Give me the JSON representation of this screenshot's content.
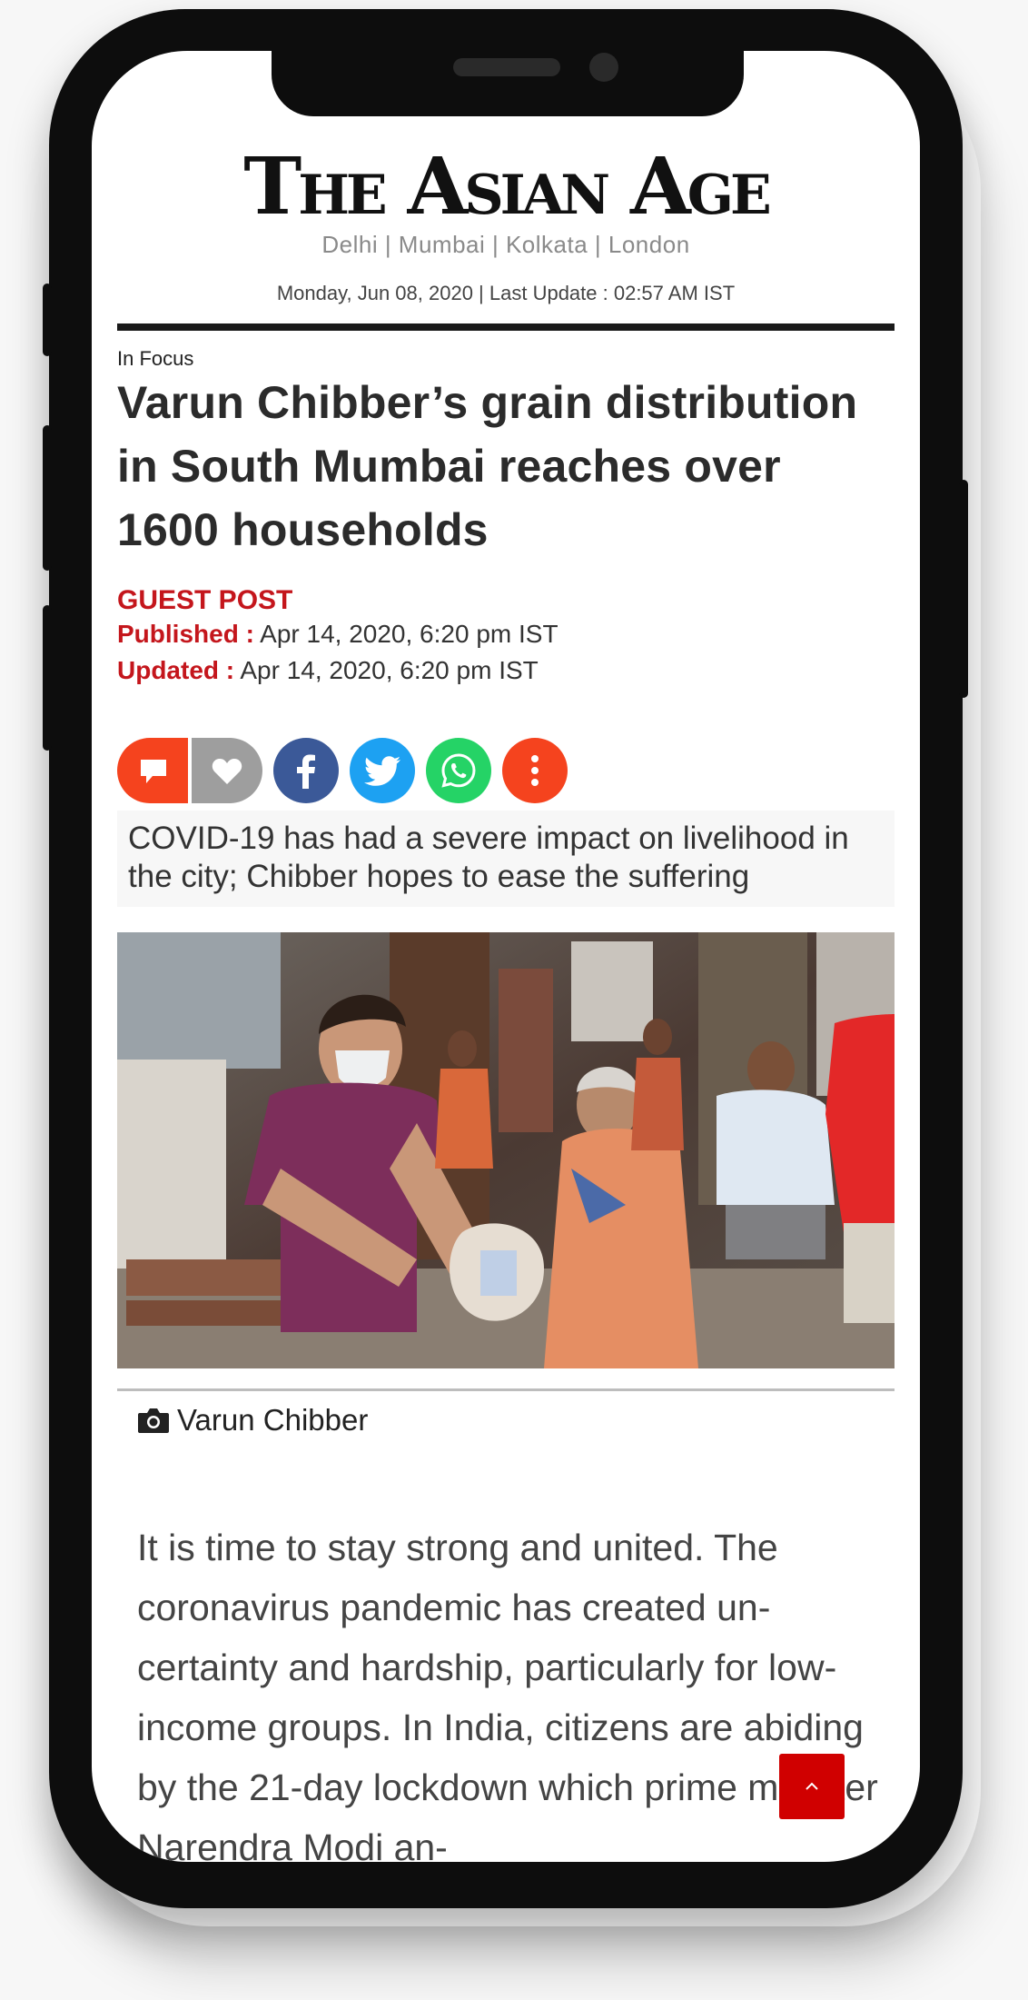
{
  "masthead": {
    "logo": "The Asian Age",
    "cities": "Delhi | Mumbai | Kolkata | London",
    "dateline": "Monday, Jun 08, 2020 | Last Update : 02:57 AM IST"
  },
  "article": {
    "category": "In Focus",
    "headline": "Varun Chibber’s grain distribution in South Mumbai reaches over 1600 households",
    "byline": "GUEST POST",
    "published_label": "Published :",
    "published_value": "Apr 14, 2020, 6:20 pm IST",
    "updated_label": "Updated :",
    "updated_value": "Apr 14, 2020, 6:20 pm IST",
    "summary": "COVID-19 has had a severe impact on livelihood in the city; Chibber hopes to ease the suffering",
    "photo_credit": "Varun Chibber",
    "body": "It is time to stay strong and united. The coronavirus pandemic has created un-certainty and hardship, particularly for low-income groups. In India, citizens are abiding by the 21-day lockdown which prime minister Narendra Modi an-"
  },
  "share": {
    "icons": [
      "comment-icon",
      "heart-icon",
      "facebook-icon",
      "twitter-icon",
      "whatsapp-icon",
      "more-icon"
    ],
    "colors": {
      "comment": "#f5431e",
      "like": "#9e9e9e",
      "facebook": "#3b5998",
      "twitter": "#1da1f2",
      "whatsapp": "#25d366",
      "more": "#f5431e"
    }
  },
  "colors": {
    "accent": "#c4161c",
    "scroll_top": "#d00000"
  }
}
